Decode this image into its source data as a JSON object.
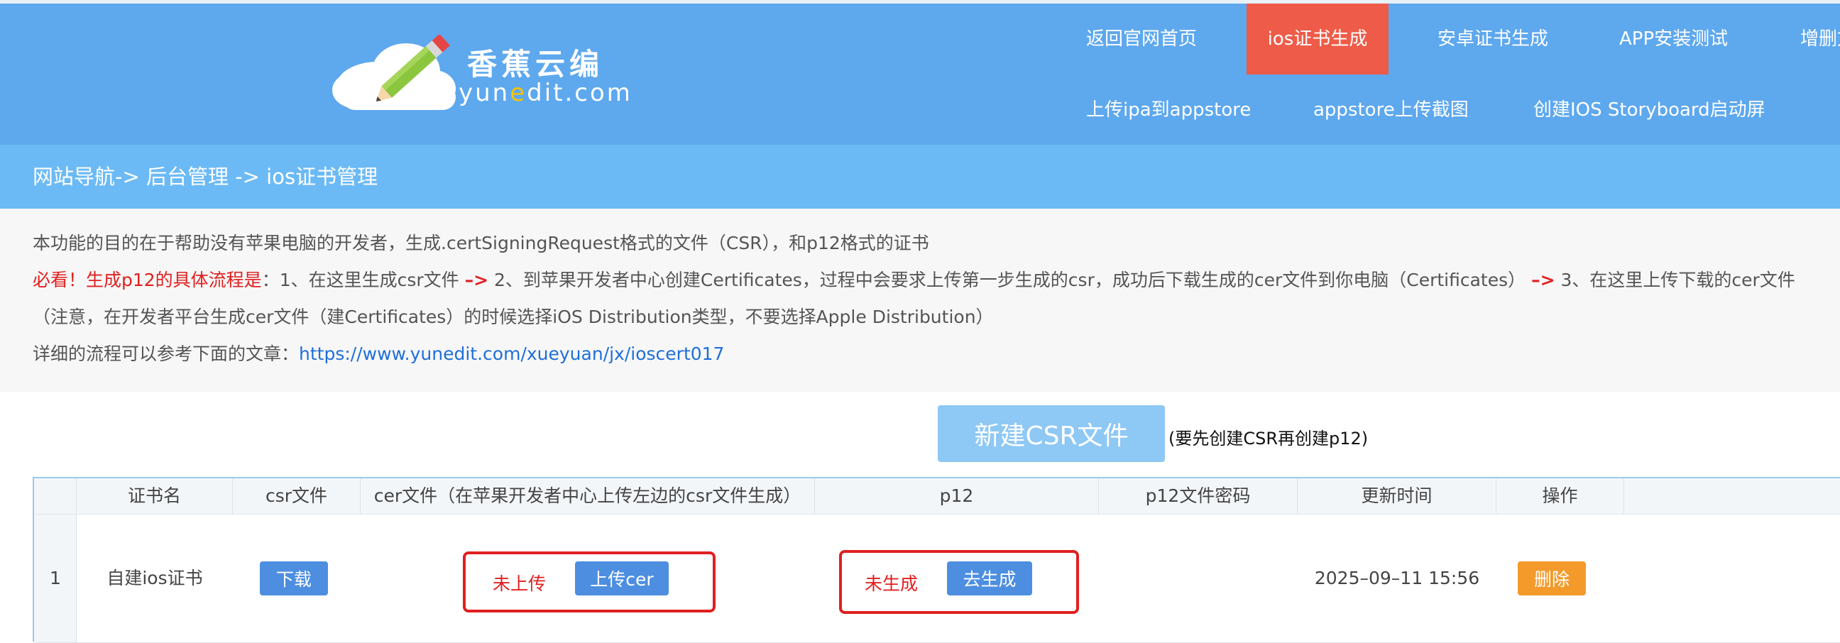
{
  "logo": {
    "name_cn": "香蕉云编",
    "name_en_pre": "yun",
    "name_en_mid": "e",
    "name_en_post": "dit.com"
  },
  "nav": {
    "row1": [
      "返回官网首页",
      "ios证书生成",
      "安卓证书生成",
      "APP安装测试",
      "增删文"
    ],
    "row2": [
      "上传ipa到appstore",
      "appstore上传截图",
      "创建IOS Storyboard启动屏"
    ],
    "active": "ios证书生成"
  },
  "breadcrumb": "网站导航-> 后台管理 -> ios证书管理",
  "info": {
    "line1": "本功能的目的在于帮助没有苹果电脑的开发者，生成.certSigningRequest格式的文件（CSR），和p12格式的证书",
    "line2_highlight": "必看！生成p12的具体流程是",
    "line2_step1": "：1、在这里生成csr文件",
    "line2_arrow": "–>",
    "line2_step2": "2、到苹果开发者中心创建Certificates，过程中会要求上传第一步生成的csr，成功后下载生成的cer文件到你电脑（Certificates）",
    "line2_step3": "3、在这里上传下载的cer文件",
    "line3": "（注意，在开发者平台生成cer文件（建Certificates）的时候选择iOS Distribution类型，不要选择Apple Distribution）",
    "line4_label": "详细的流程可以参考下面的文章：",
    "line4_link": "https://www.yunedit.com/xueyuan/jx/ioscert017"
  },
  "actions": {
    "new_csr": "新建CSR文件",
    "hint": "(要先创建CSR再创建p12)"
  },
  "table": {
    "columns": [
      "证书名",
      "csr文件",
      "cer文件（在苹果开发者中心上传左边的csr文件生成）",
      "p12",
      "p12文件密码",
      "更新时间",
      "操作"
    ],
    "rows": [
      {
        "index": "1",
        "name": "自建ios证书",
        "csr_button": "下载",
        "cer_status": "未上传",
        "cer_button": "上传cer",
        "p12_status": "未生成",
        "p12_button": "去生成",
        "password": "",
        "updated": "2025–09–11 15:56",
        "delete_button": "删除"
      }
    ]
  },
  "colors": {
    "header_bg": "#5ea8ee",
    "nav_active": "#ee5c49",
    "breadcrumb_bg": "#6cbaf5",
    "primary_button": "#4d8ee0",
    "danger_button": "#f39a2b",
    "warning_text": "#e02020"
  }
}
